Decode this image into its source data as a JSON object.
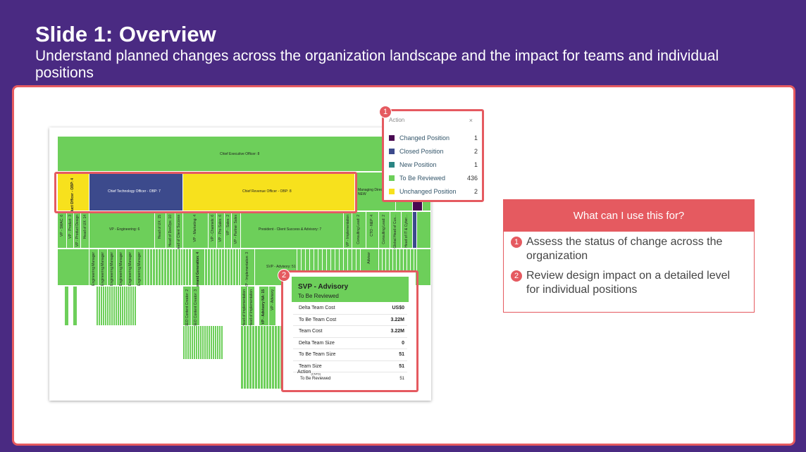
{
  "slide": {
    "title": "Slide 1: Overview",
    "subtitle": "Understand planned changes across the organization landscape and the impact for teams and individual positions"
  },
  "orgchart": {
    "ceo": "Chief Executive Officer: 8",
    "row2": [
      {
        "label": "Chief Product Officer - OBP: 4",
        "status": "Unchanged Position"
      },
      {
        "label": "Chief Technology Officer - OBP: 7",
        "status": "Closed Position"
      },
      {
        "label": "Chief Revenue Officer - OBP: 8",
        "status": "Unchanged Position"
      },
      {
        "label": "Managing Director - NEW",
        "status": "To Be Reviewed"
      }
    ],
    "row3": [
      "VP - SMAC: 6",
      "VP - Product: 3",
      "VP - Product Design",
      "Head of UX: 14",
      "VP - Engineering: 6",
      "Head of UX: 15",
      "Head of DevOps: 10",
      "Head of Client Success",
      "VP - Marketing: 4",
      "VP - Channels: 6",
      "VP - Pre-Sales: 6",
      "VP - Sales: 2",
      "VP - Partner Sales",
      "President - Client Success & Advisory: 7",
      "VP - Implementation",
      "Consulting Lead: 2",
      "CTO - NEP: 4",
      "Consulting Lead: 2",
      "Global Head of Cus...",
      "Head of IT & Cyber..."
    ],
    "row4": [
      "Engineering Manager",
      "Engineering Manager",
      "Engineering Manager",
      "Engineering Manager",
      "Engineering Manager",
      "Engineering Manager",
      "Head of Demand Generation: 4",
      "VP - Implementation: 3",
      "SVP - Advisory: 51",
      "Advisor"
    ],
    "row5": [
      "SEO Content Creator: 2",
      "SEO Content Creator: 3",
      "Head of Implementation",
      "Head of Implementation",
      "VP - Advisory NA: 15",
      "VP - Advisory"
    ]
  },
  "legend": {
    "title": "Action",
    "close": "×",
    "items": [
      {
        "name": "Changed Position",
        "count": "1",
        "color": "#4a0a52"
      },
      {
        "name": "Closed Position",
        "count": "2",
        "color": "#3c4a8c"
      },
      {
        "name": "New Position",
        "count": "1",
        "color": "#2a8583"
      },
      {
        "name": "To Be Reviewed",
        "count": "436",
        "color": "#6dcf5a"
      },
      {
        "name": "Unchanged Position",
        "count": "2",
        "color": "#f7e11d"
      }
    ]
  },
  "card": {
    "title": "SVP - Advisory",
    "status": "To Be Reviewed",
    "rows": [
      {
        "k": "Delta Team Cost",
        "v": "US$0"
      },
      {
        "k": "To Be Team Cost",
        "v": "3.22M"
      },
      {
        "k": "Team Cost",
        "v": "3.22M"
      },
      {
        "k": "Delta Team Size",
        "v": "0"
      },
      {
        "k": "To Be Team Size",
        "v": "51"
      },
      {
        "k": "Team Size",
        "v": "51"
      }
    ],
    "action_label": "Action",
    "action_sub": "(CNTD)",
    "action_value": "To Be Reviewed",
    "action_count": "51"
  },
  "usebox": {
    "title": "What can I use this for?",
    "items": [
      {
        "num": "1",
        "text": "Assess the status of change across the organization"
      },
      {
        "num": "2",
        "text": "Review design impact on a detailed level for individual positions"
      }
    ]
  },
  "badges": [
    "1",
    "2"
  ],
  "colors": {
    "background": "#4a2a82",
    "accent": "#e55a60",
    "to_be_reviewed": "#6dcf5a",
    "unchanged": "#f7e11d",
    "closed": "#3c4a8c",
    "changed": "#4a0a52"
  }
}
